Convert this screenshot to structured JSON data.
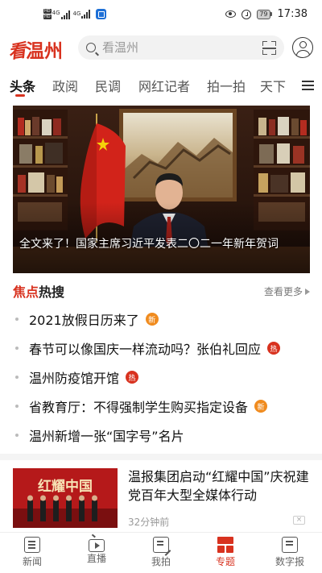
{
  "status_bar": {
    "sim1": {
      "hd_top": "HD",
      "hd_bottom": "HD",
      "network": "4G"
    },
    "sim2": {
      "network": "4G"
    },
    "battery": "79",
    "time": "17:38"
  },
  "header": {
    "logo_kan": "看",
    "logo_name": "温州",
    "search_placeholder": "看温州"
  },
  "tabs": [
    {
      "label": "头条"
    },
    {
      "label": "政阅"
    },
    {
      "label": "民调"
    },
    {
      "label": "网红记者"
    },
    {
      "label": "拍一拍"
    },
    {
      "label": "天下"
    }
  ],
  "hero": {
    "caption": "全文来了！国家主席习近平发表二〇二一年新年贺词"
  },
  "hot": {
    "title_accent": "焦点",
    "title_rest": "热搜",
    "more": "查看更多",
    "items": [
      {
        "text": "2021放假日历来了",
        "badge": "新",
        "badge_type": "new"
      },
      {
        "text": "春节可以像国庆一样流动吗？张伯礼回应",
        "badge": "热",
        "badge_type": "hot"
      },
      {
        "text": "温州防疫馆开馆",
        "badge": "热",
        "badge_type": "hot"
      },
      {
        "text": "省教育厅：不得强制学生购买指定设备",
        "badge": "新",
        "badge_type": "new"
      },
      {
        "text": "温州新增一张“国字号”名片",
        "badge": "",
        "badge_type": ""
      }
    ]
  },
  "card": {
    "image_text": "红耀中国",
    "title": "温报集团启动“红耀中国”庆祝建党百年大型全媒体行动",
    "time": "32分钟前",
    "close": "×"
  },
  "bottom_nav": [
    {
      "label": "新闻",
      "icon": "news-icon",
      "active": false
    },
    {
      "label": "直播",
      "icon": "live-icon",
      "active": false
    },
    {
      "label": "我拍",
      "icon": "shoot-icon",
      "active": false
    },
    {
      "label": "专题",
      "icon": "topic-icon",
      "active": true
    },
    {
      "label": "数字报",
      "icon": "paper-icon",
      "active": false
    }
  ],
  "colors": {
    "brand": "#d8321f",
    "new_badge": "#f08b1e",
    "hot_badge": "#d8321f"
  }
}
